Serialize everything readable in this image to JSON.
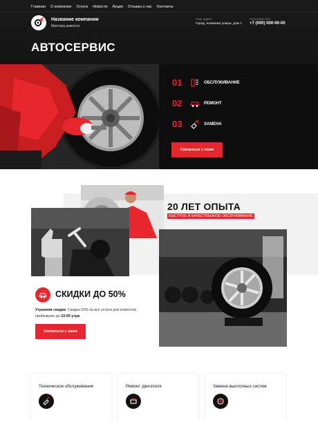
{
  "nav": {
    "items": [
      "Главная",
      "О компании",
      "Услуги",
      "Новости",
      "Акции",
      "Отзывы о нас",
      "Контакты"
    ]
  },
  "header": {
    "company_name": "Название компании",
    "company_sub": "Мастера ремонта",
    "address_label": "Наш адрес:",
    "address_value": "Город, название улицы, дом 1",
    "phone_label": "Работаем 24/7",
    "phone_value": "+7 (000) 000-00-00"
  },
  "hero": {
    "title": "АВТОСЕРВИС",
    "services": [
      {
        "num": "01",
        "label": "ОБСЛУЖИВАНИЕ",
        "icon": "service-tools-icon"
      },
      {
        "num": "02",
        "label": "РЕМОНТ",
        "icon": "car-repair-icon"
      },
      {
        "num": "03",
        "label": "ЗАМЕНА",
        "icon": "hand-wrench-icon"
      }
    ],
    "cta_label": "Связаться с нами"
  },
  "experience": {
    "title": "20 ЛЕТ ОПЫТА",
    "subtitle": "БЫСТРОЕ И КАЧЕСТВЕННОЕ ОБСЛУЖИВАНИЕ"
  },
  "discount": {
    "title": "СКИДКИ ДО 50%",
    "text_bold": "Утренняя скидка",
    "text_main": ": Скидка 20% на все услуги для клиентов, прибывших до ",
    "text_time": "10:00 утра",
    "cta_label": "Связаться с нами"
  },
  "cards": [
    {
      "title": "Техническое обслуживание",
      "icon": "car-service-icon"
    },
    {
      "title": "Ремонт двигателя",
      "icon": "engine-icon"
    },
    {
      "title": "Замена выхлопных систем",
      "icon": "exhaust-icon"
    }
  ],
  "colors": {
    "accent": "#e8262d",
    "dark": "#0e0e0e"
  }
}
